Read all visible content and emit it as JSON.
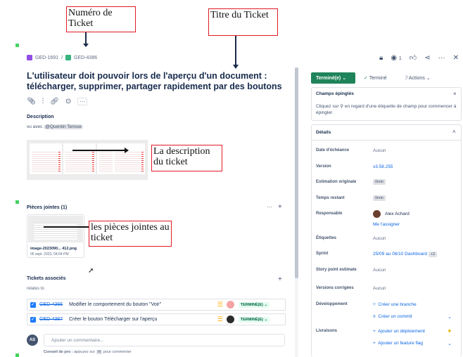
{
  "annotations": {
    "ticket_number": "Numéro de Ticket",
    "ticket_title": "Titre du Ticket",
    "description": "La description du ticket",
    "attachments": "les pièces jointes au ticket"
  },
  "breadcrumb": {
    "parent": "GED-1691",
    "separator": "/",
    "current": "GED-4386"
  },
  "topbar": {
    "watch_count": "1"
  },
  "issue": {
    "title": "L'utilisateur doit pouvoir lors de l'aperçu d'un document : télécharger, supprimer, partager rapidement par des boutons",
    "description_label": "Description",
    "description_text": "vu avec",
    "mention": "@Quentin Terisse"
  },
  "attachments": {
    "header": "Pièces jointes (1)",
    "file_name": "image-2023090... 412.png",
    "file_date": "05 sept. 2023, 04:04 PM"
  },
  "linked": {
    "header": "Tickets associés",
    "relation": "relates to",
    "items": [
      {
        "key": "GED-4366",
        "summary": "Modifier le comportement du bouton \"Voir\"",
        "status": "TERMINÉ(E) ⌄"
      },
      {
        "key": "GED-4387",
        "summary": "Créer le bouton Télécharger sur l'aperçu",
        "status": "TERMINÉ(E) ⌄"
      }
    ]
  },
  "comment": {
    "avatar": "AS",
    "placeholder": "Ajouter un commentaire...",
    "tip_bold": "Conseil de pro :",
    "tip_text_1": "appuyez sur",
    "tip_key": "M",
    "tip_text_2": "pour commenter"
  },
  "panel": {
    "status_button": "Terminé(e)  ⌄",
    "resolution": "Terminé",
    "actions": "Actions",
    "pinned_title": "Champs épinglés",
    "pinned_text": "Cliquez sur ⚲ en regard d'une étiquette de champ pour commencer à épingler.",
    "details_title": "Détails",
    "fields": [
      {
        "label": "Date d'échéance",
        "value": "Aucun"
      },
      {
        "label": "Version",
        "value": "v3.58.255"
      },
      {
        "label": "Estimation originale",
        "value": "0min"
      },
      {
        "label": "Temps restant",
        "value": "0min"
      },
      {
        "label": "Responsable",
        "value": "Alex Achard",
        "extra": "Me l'assigner"
      },
      {
        "label": "Étiquettes",
        "value": "Aucun"
      },
      {
        "label": "Sprint",
        "value": "25/09 au 06/10 Dashboard",
        "extra": "+2"
      },
      {
        "label": "Story point estimate",
        "value": "Aucun"
      },
      {
        "label": "Versions corrigées",
        "value": "Aucun"
      },
      {
        "label": "Développement",
        "value": "Créer une branche",
        "extra": "Créer un commit"
      },
      {
        "label": "Livraisons",
        "value": "Ajouter un déploiement",
        "extra": "Ajouter un feature flag"
      }
    ]
  },
  "colors": {
    "accent": "#0c66e4",
    "done_green": "#1f845a",
    "annotation_border": "#e01b24"
  }
}
